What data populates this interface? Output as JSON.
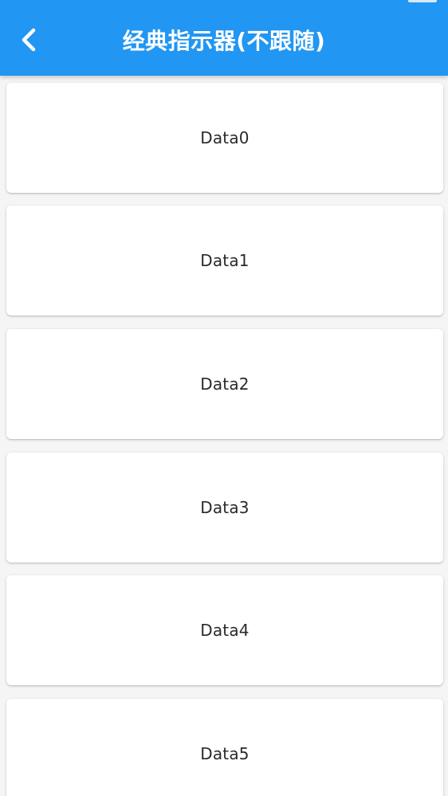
{
  "appbar": {
    "title": "经典指示器(不跟随)",
    "back_icon": "chevron-left-icon",
    "color": "#2196f3"
  },
  "list": {
    "items": [
      {
        "label": "Data0"
      },
      {
        "label": "Data1"
      },
      {
        "label": "Data2"
      },
      {
        "label": "Data3"
      },
      {
        "label": "Data4"
      },
      {
        "label": "Data5"
      }
    ]
  }
}
